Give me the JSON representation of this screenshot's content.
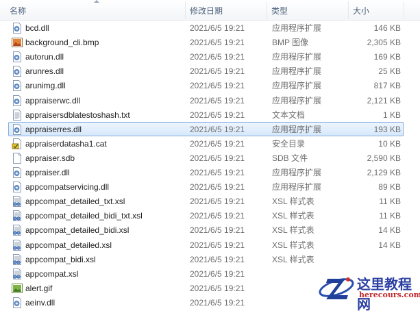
{
  "columns": {
    "name": "名称",
    "date": "修改日期",
    "type": "类型",
    "size": "大小"
  },
  "files": [
    {
      "name": "bcd.dll",
      "date": "2021/6/5 19:21",
      "type": "应用程序扩展",
      "size": "146 KB",
      "icon": "dll-file-icon"
    },
    {
      "name": "background_cli.bmp",
      "date": "2021/6/5 19:21",
      "type": "BMP 图像",
      "size": "2,305 KB",
      "icon": "bmp-image-icon"
    },
    {
      "name": "autorun.dll",
      "date": "2021/6/5 19:21",
      "type": "应用程序扩展",
      "size": "169 KB",
      "icon": "dll-file-icon"
    },
    {
      "name": "arunres.dll",
      "date": "2021/6/5 19:21",
      "type": "应用程序扩展",
      "size": "25 KB",
      "icon": "dll-file-icon"
    },
    {
      "name": "arunimg.dll",
      "date": "2021/6/5 19:21",
      "type": "应用程序扩展",
      "size": "817 KB",
      "icon": "dll-file-icon"
    },
    {
      "name": "appraiserwc.dll",
      "date": "2021/6/5 19:21",
      "type": "应用程序扩展",
      "size": "2,121 KB",
      "icon": "dll-file-icon"
    },
    {
      "name": "appraisersdblatestoshash.txt",
      "date": "2021/6/5 19:21",
      "type": "文本文档",
      "size": "1 KB",
      "icon": "text-file-icon"
    },
    {
      "name": "appraiserres.dll",
      "date": "2021/6/5 19:21",
      "type": "应用程序扩展",
      "size": "193 KB",
      "icon": "dll-file-icon",
      "selected": true
    },
    {
      "name": "appraiserdatasha1.cat",
      "date": "2021/6/5 19:21",
      "type": "安全目录",
      "size": "10 KB",
      "icon": "catalog-file-icon"
    },
    {
      "name": "appraiser.sdb",
      "date": "2021/6/5 19:21",
      "type": "SDB 文件",
      "size": "2,590 KB",
      "icon": "blank-file-icon"
    },
    {
      "name": "appraiser.dll",
      "date": "2021/6/5 19:21",
      "type": "应用程序扩展",
      "size": "2,129 KB",
      "icon": "dll-file-icon"
    },
    {
      "name": "appcompatservicing.dll",
      "date": "2021/6/5 19:21",
      "type": "应用程序扩展",
      "size": "89 KB",
      "icon": "dll-file-icon"
    },
    {
      "name": "appcompat_detailed_txt.xsl",
      "date": "2021/6/5 19:21",
      "type": "XSL 样式表",
      "size": "11 KB",
      "icon": "xsl-file-icon"
    },
    {
      "name": "appcompat_detailed_bidi_txt.xsl",
      "date": "2021/6/5 19:21",
      "type": "XSL 样式表",
      "size": "11 KB",
      "icon": "xsl-file-icon"
    },
    {
      "name": "appcompat_detailed_bidi.xsl",
      "date": "2021/6/5 19:21",
      "type": "XSL 样式表",
      "size": "14 KB",
      "icon": "xsl-file-icon"
    },
    {
      "name": "appcompat_detailed.xsl",
      "date": "2021/6/5 19:21",
      "type": "XSL 样式表",
      "size": "14 KB",
      "icon": "xsl-file-icon"
    },
    {
      "name": "appcompat_bidi.xsl",
      "date": "2021/6/5 19:21",
      "type": "XSL 样式表",
      "size": "",
      "icon": "xsl-file-icon"
    },
    {
      "name": "appcompat.xsl",
      "date": "2021/6/5 19:21",
      "type": "",
      "size": "",
      "icon": "xsl-file-icon"
    },
    {
      "name": "alert.gif",
      "date": "2021/6/5 19:21",
      "type": "",
      "size": "",
      "icon": "gif-image-icon"
    },
    {
      "name": "aeinv.dll",
      "date": "2021/6/5 19:21",
      "type": "",
      "size": "",
      "icon": "dll-file-icon"
    }
  ],
  "watermark": {
    "title": "这里教程网",
    "url": "herecours.com",
    "logo_letter": "Z"
  }
}
